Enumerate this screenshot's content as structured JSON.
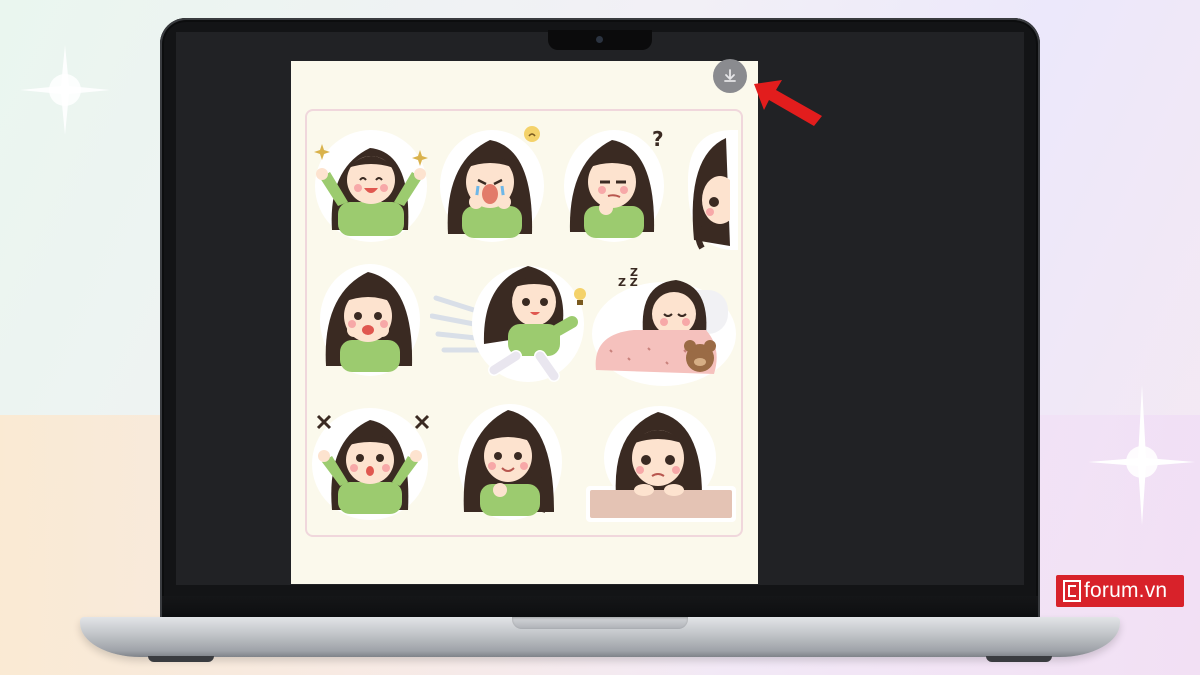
{
  "viewer": {
    "download_icon": "download-icon",
    "pointer_icon": "red-arrow-icon"
  },
  "brand": {
    "logo_text": "forum.vn",
    "color": "#d8222a"
  },
  "colors": {
    "sheet_background": "#fbf9ec",
    "sweater": "#9ccb6f",
    "hair": "#3a2a22",
    "download_button": "#8a8b8f",
    "arrow": "#e21d1d"
  },
  "stickers": [
    {
      "id": "cheer",
      "icon": "cheering-girl-sticker"
    },
    {
      "id": "crying",
      "icon": "crying-girl-sticker"
    },
    {
      "id": "thinking",
      "icon": "thinking-girl-sticker"
    },
    {
      "id": "peek",
      "icon": "peeking-girl-sticker"
    },
    {
      "id": "shy",
      "icon": "shy-girl-sticker"
    },
    {
      "id": "running",
      "icon": "running-girl-sticker"
    },
    {
      "id": "sleeping",
      "icon": "sleeping-girl-sticker"
    },
    {
      "id": "surprised",
      "icon": "surprised-girl-sticker"
    },
    {
      "id": "smile",
      "icon": "smiling-girl-sticker"
    },
    {
      "id": "sad",
      "icon": "sad-girl-sticker"
    }
  ]
}
